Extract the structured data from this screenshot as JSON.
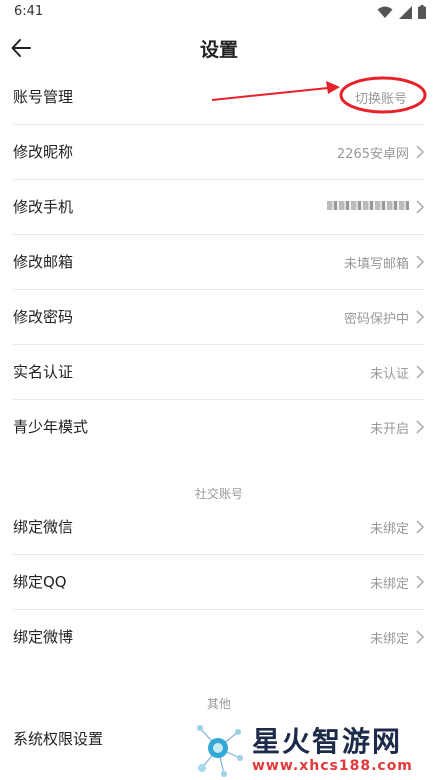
{
  "status_bar": {
    "time": "6:41",
    "icons": [
      "wifi-icon",
      "signal-icon",
      "battery-icon"
    ]
  },
  "header": {
    "title": "设置",
    "back_icon": "arrow-left-icon"
  },
  "account": {
    "label": "账号管理",
    "value": "切换账号"
  },
  "rows": [
    {
      "label": "修改昵称",
      "value": "2265安卓网"
    },
    {
      "label": "修改手机",
      "value": ""
    },
    {
      "label": "修改邮箱",
      "value": "未填写邮箱"
    },
    {
      "label": "修改密码",
      "value": "密码保护中"
    },
    {
      "label": "实名认证",
      "value": "未认证"
    },
    {
      "label": "青少年模式",
      "value": "未开启"
    }
  ],
  "social_section": {
    "title": "社交账号",
    "rows": [
      {
        "label": "绑定微信",
        "value": "未绑定"
      },
      {
        "label": "绑定QQ",
        "value": "未绑定"
      },
      {
        "label": "绑定微博",
        "value": "未绑定"
      }
    ]
  },
  "other_section": {
    "title": "其他",
    "rows": [
      {
        "label": "系统权限设置"
      }
    ]
  },
  "watermark": {
    "brand": "星火智游网",
    "url": "www.xhcs188.com"
  },
  "colors": {
    "annotation": "#e8202a",
    "text_primary": "#222222",
    "text_secondary": "#999999",
    "divider": "#e9e9e9"
  }
}
